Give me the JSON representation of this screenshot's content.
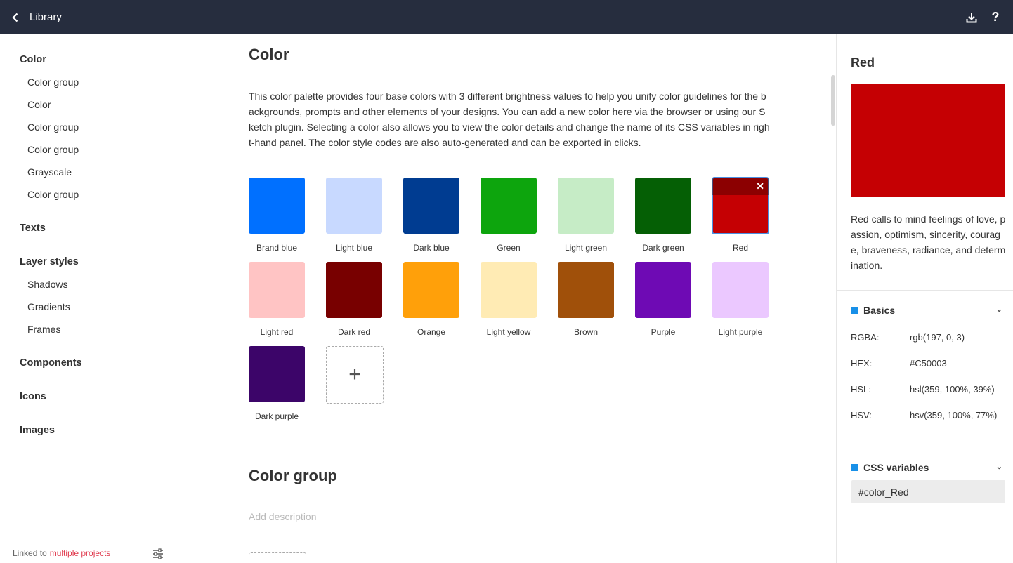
{
  "topbar": {
    "title": "Library",
    "icons": {
      "back": "chevron-left-icon",
      "download": "download-icon",
      "help": "help-icon"
    },
    "help_glyph": "?"
  },
  "sidebar": {
    "sections": [
      {
        "label": "Color",
        "items": [
          "Color group",
          "Color",
          "Color group",
          "Color group",
          "Grayscale",
          "Color group"
        ]
      },
      {
        "label": "Texts",
        "items": []
      },
      {
        "label": "Layer styles",
        "items": [
          "Shadows",
          "Gradients",
          "Frames"
        ]
      },
      {
        "label": "Components",
        "items": []
      },
      {
        "label": "Icons",
        "items": []
      },
      {
        "label": "Images",
        "items": []
      }
    ],
    "footer": {
      "prefix": "Linked to",
      "link": "multiple projects",
      "icon": "settings-icon"
    }
  },
  "main": {
    "title": "Color",
    "description": "This color palette provides four base colors with 3 different brightness values to help you unify color guidelines for the backgrounds, prompts and other elements of your designs. You can add a new color here via the browser or using our Sketch plugin. Selecting a color also allows you to view the color details and change the name of its CSS variables in right-hand panel. The color style codes are also auto-generated and can be exported in clicks.",
    "swatches": [
      {
        "name": "Brand blue",
        "color": "#0070ff"
      },
      {
        "name": "Light blue",
        "color": "#c8d9ff"
      },
      {
        "name": "Dark blue",
        "color": "#003c91"
      },
      {
        "name": "Green",
        "color": "#0da50d"
      },
      {
        "name": "Light green",
        "color": "#c6ecc6"
      },
      {
        "name": "Dark green",
        "color": "#055f05"
      },
      {
        "name": "Red",
        "color": "#C50003",
        "selected": true
      },
      {
        "name": "Light red",
        "color": "#ffc4c4"
      },
      {
        "name": "Dark red",
        "color": "#780000"
      },
      {
        "name": "Orange",
        "color": "#ffa00a"
      },
      {
        "name": "Light yellow",
        "color": "#ffebb4"
      },
      {
        "name": "Brown",
        "color": "#a0500a"
      },
      {
        "name": "Purple",
        "color": "#6e0ab4"
      },
      {
        "name": "Light purple",
        "color": "#ebc8ff"
      },
      {
        "name": "Dark purple",
        "color": "#3c0569"
      }
    ],
    "add_glyph": "+",
    "close_glyph": "✕",
    "group": {
      "title": "Color group",
      "description_placeholder": "Add description"
    }
  },
  "panel": {
    "title": "Red",
    "color": "#C50003",
    "description": "Red calls to mind feelings of love, passion, optimism, sincerity, courage, braveness, radiance, and determination.",
    "basics": {
      "label": "Basics",
      "rows": [
        {
          "key": "RGBA:",
          "value": "rgb(197, 0, 3)"
        },
        {
          "key": "HEX:",
          "value": "#C50003"
        },
        {
          "key": "HSL:",
          "value": "hsl(359, 100%, 39%)"
        },
        {
          "key": "HSV:",
          "value": "hsv(359, 100%, 77%)"
        }
      ]
    },
    "css": {
      "label": "CSS variables",
      "value": "#color_Red"
    },
    "accent": "#1890e8",
    "chevron_glyph": "⌄"
  }
}
